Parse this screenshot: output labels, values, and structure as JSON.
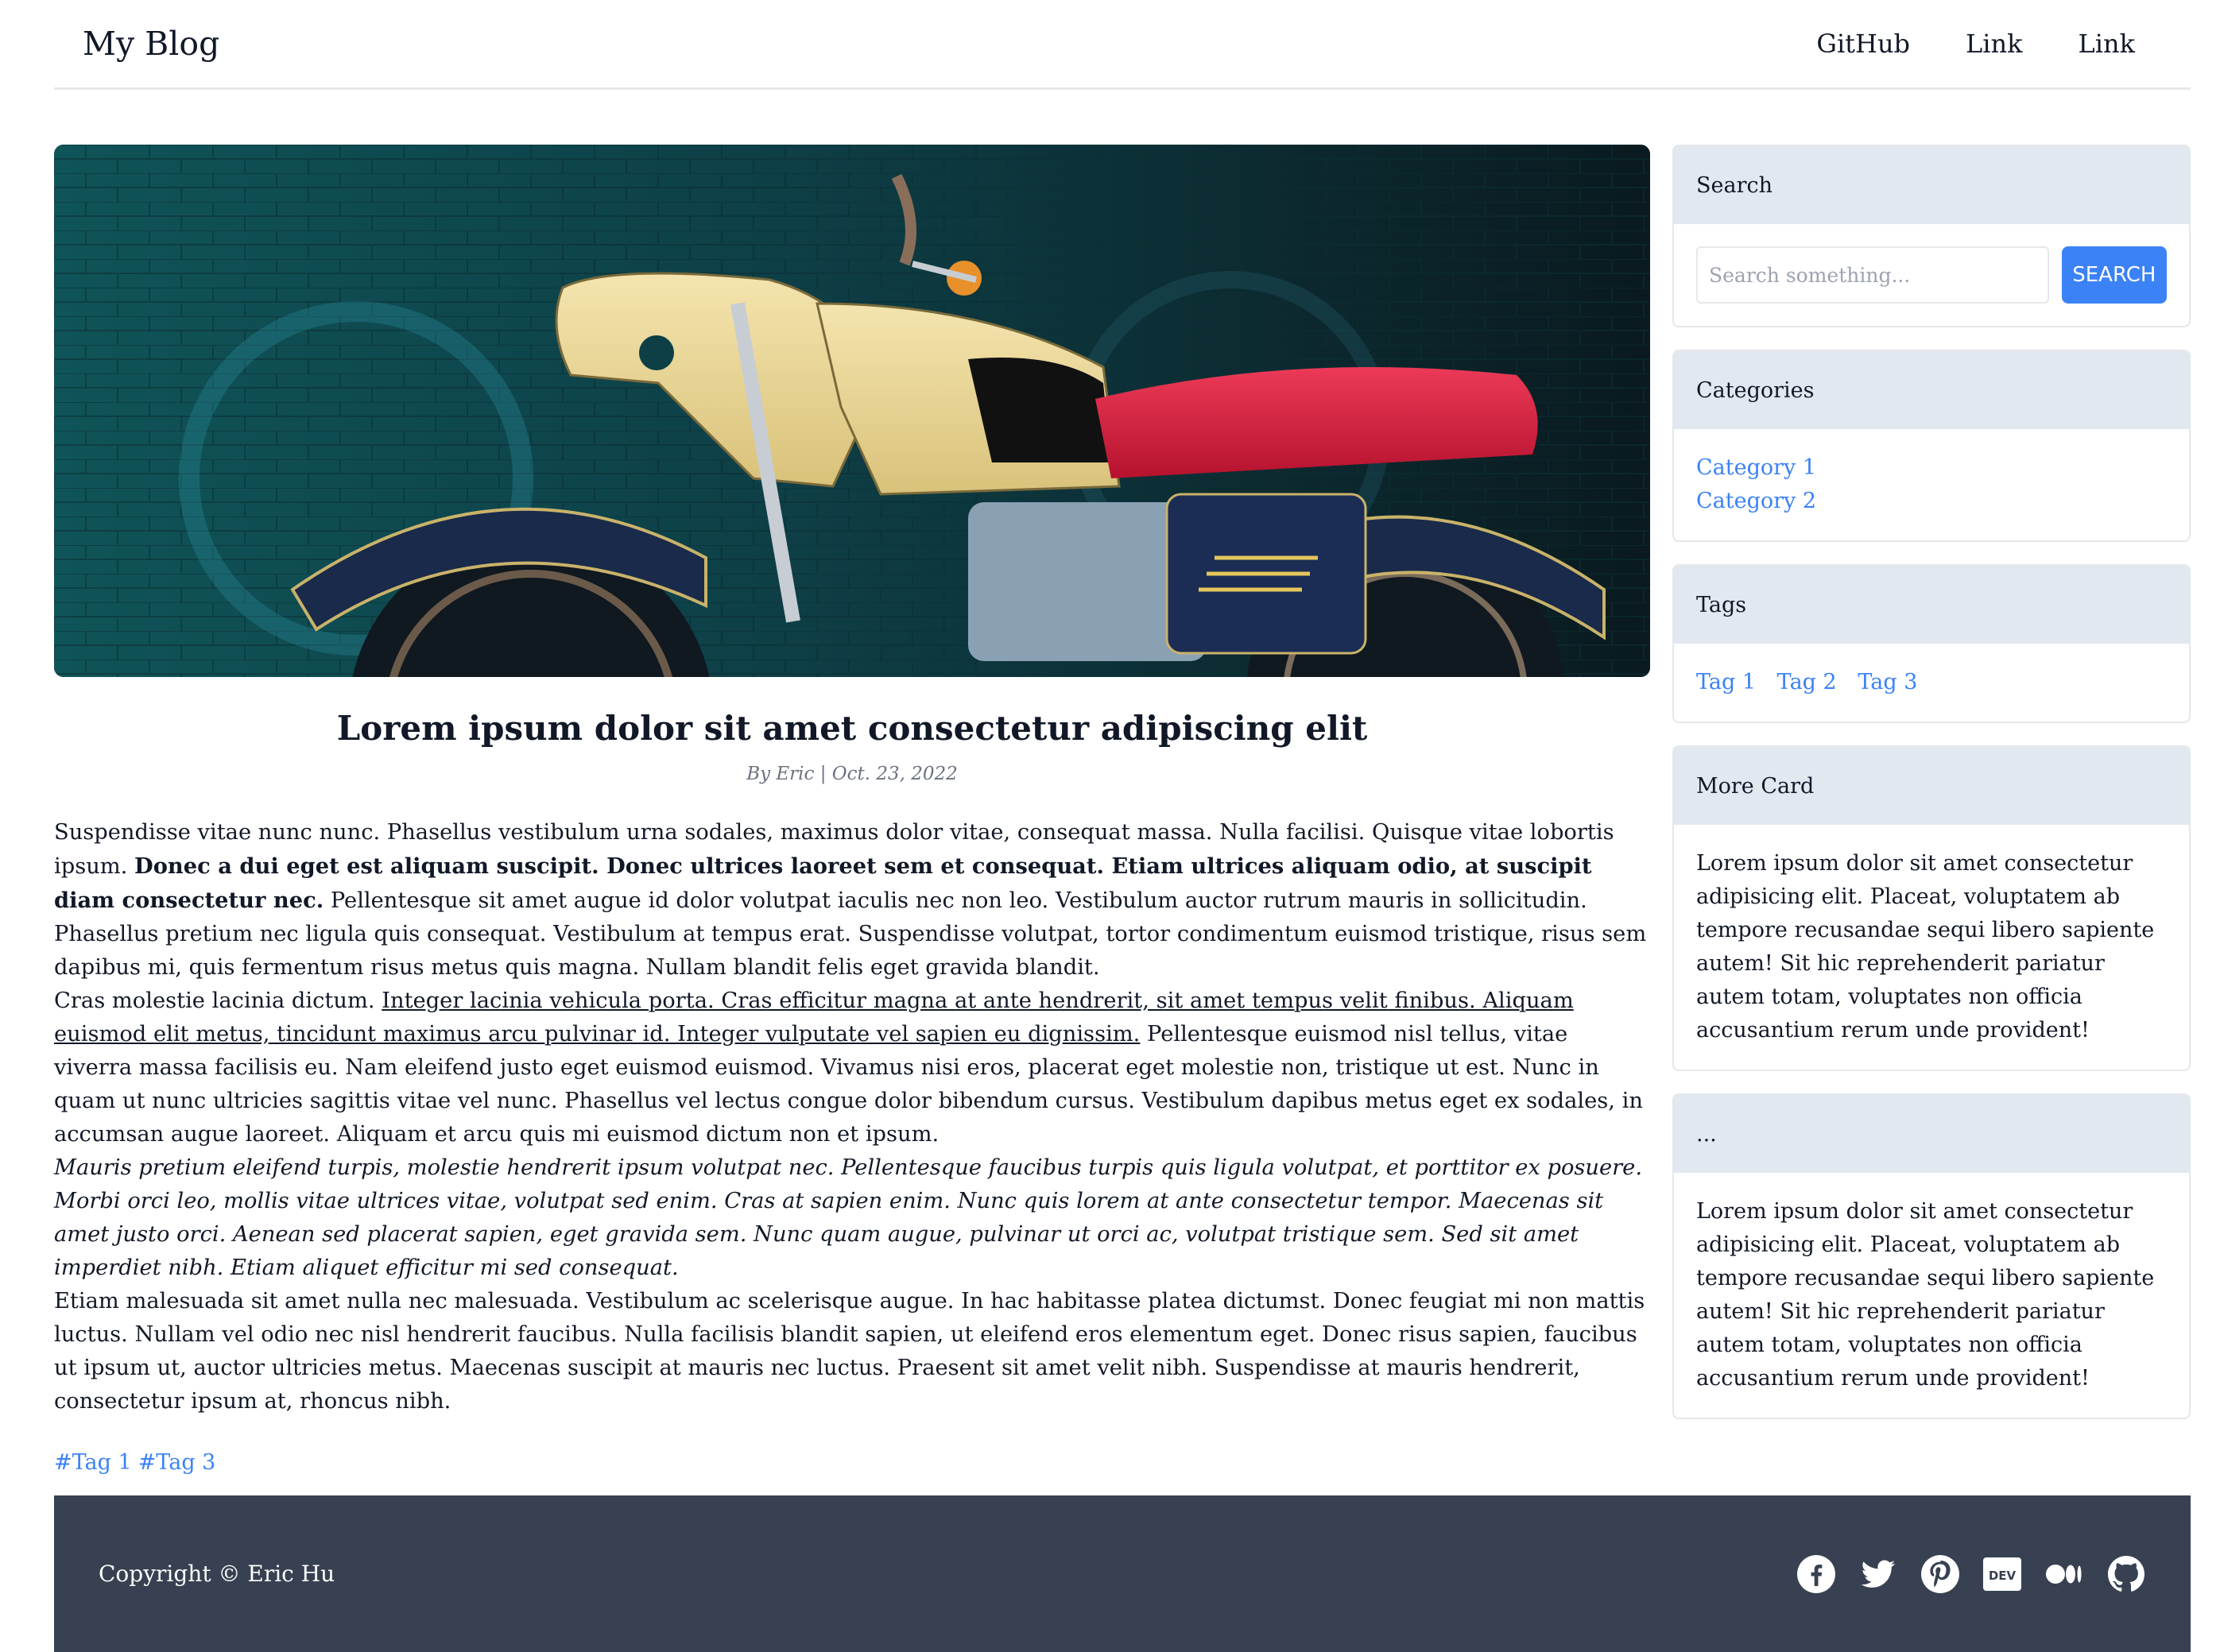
{
  "nav": {
    "brand": "My Blog",
    "links": [
      "GitHub",
      "Link",
      "Link"
    ]
  },
  "post": {
    "title": "Lorem ipsum dolor sit amet consectetur adipiscing elit",
    "meta": "By Eric | Oct. 23, 2022",
    "p1_a": "Suspendisse vitae nunc nunc. Phasellus vestibulum urna sodales, maximus dolor vitae, consequat massa. Nulla facilisi. Quisque vitae lobortis ipsum. ",
    "p1_bold": "Donec a dui eget est aliquam suscipit. Donec ultrices laoreet sem et consequat. Etiam ultrices aliquam odio, at suscipit diam consectetur nec.",
    "p1_b": " Pellentesque sit amet augue id dolor volutpat iaculis nec non leo. Vestibulum auctor rutrum mauris in sollicitudin. Phasellus pretium nec ligula quis consequat. Vestibulum at tempus erat. Suspendisse volutpat, tortor condimentum euismod tristique, risus sem dapibus mi, quis fermentum risus metus quis magna. Nullam blandit felis eget gravida blandit.",
    "p2_a": "Cras molestie lacinia dictum. ",
    "p2_underline": "Integer lacinia vehicula porta. Cras efficitur magna at ante hendrerit, sit amet tempus velit finibus. Aliquam euismod elit metus, tincidunt maximus arcu pulvinar id. Integer vulputate vel sapien eu dignissim.",
    "p2_b": " Pellentesque euismod nisl tellus, vitae viverra massa facilisis eu. Nam eleifend justo eget euismod euismod. Vivamus nisi eros, placerat eget molestie non, tristique ut est. Nunc in quam ut nunc ultricies sagittis vitae vel nunc. Phasellus vel lectus congue dolor bibendum cursus. Vestibulum dapibus metus eget ex sodales, in accumsan augue laoreet. Aliquam et arcu quis mi euismod dictum non et ipsum.",
    "p3_italic": "Mauris pretium eleifend turpis, molestie hendrerit ipsum volutpat nec. Pellentesque faucibus turpis quis ligula volutpat, et porttitor ex posuere. Morbi orci leo, mollis vitae ultrices vitae, volutpat sed enim. Cras at sapien enim. Nunc quis lorem at ante consectetur tempor. Maecenas sit amet justo orci. Aenean sed placerat sapien, eget gravida sem. Nunc quam augue, pulvinar ut orci ac, volutpat tristique sem. Sed sit amet imperdiet nibh. Etiam aliquet efficitur mi sed consequat.",
    "p4": "Etiam malesuada sit amet nulla nec malesuada. Vestibulum ac scelerisque augue. In hac habitasse platea dictumst. Donec feugiat mi non mattis luctus. Nullam vel odio nec nisl hendrerit faucibus. Nulla facilisis blandit sapien, ut eleifend eros elementum eget. Donec risus sapien, faucibus ut ipsum ut, auctor ultricies metus. Maecenas suscipit at mauris nec luctus. Praesent sit amet velit nibh. Suspendisse at mauris hendrerit, consectetur ipsum at, rhoncus nibh.",
    "tags": [
      "#Tag 1",
      "#Tag 3"
    ]
  },
  "sidebar": {
    "search": {
      "header": "Search",
      "placeholder": "Search something...",
      "button": "SEARCH"
    },
    "categories": {
      "header": "Categories",
      "items": [
        "Category 1",
        "Category 2"
      ]
    },
    "tags": {
      "header": "Tags",
      "items": [
        "Tag 1",
        "Tag 2",
        "Tag 3"
      ]
    },
    "more": {
      "header": "More Card",
      "body": "Lorem ipsum dolor sit amet consectetur adipisicing elit. Placeat, voluptatem ab tempore recusandae sequi libero sapiente autem! Sit hic reprehenderit pariatur autem totam, voluptates non officia accusantium rerum unde provident!"
    },
    "extra": {
      "header": "...",
      "body": "Lorem ipsum dolor sit amet consectetur adipisicing elit. Placeat, voluptatem ab tempore recusandae sequi libero sapiente autem! Sit hic reprehenderit pariatur autem totam, voluptates non officia accusantium rerum unde provident!"
    }
  },
  "footer": {
    "copyright": "Copyright © Eric Hu",
    "icons": [
      "facebook-icon",
      "twitter-icon",
      "pinterest-icon",
      "dev-icon",
      "medium-icon",
      "github-icon"
    ],
    "dev_label": "DEV"
  },
  "colors": {
    "accent": "#3b82f6",
    "footer_bg": "#374151",
    "card_header": "#e2e8f0"
  }
}
